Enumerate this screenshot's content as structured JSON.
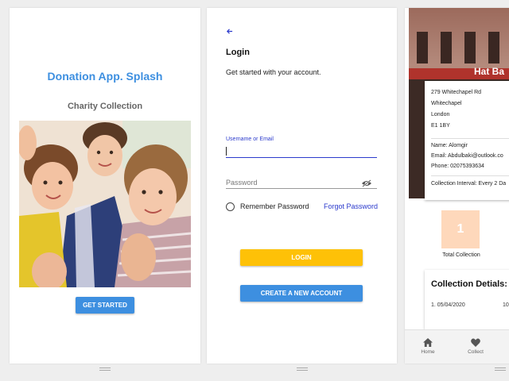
{
  "splash": {
    "title": "Donation App. Splash",
    "subtitle": "Charity Collection",
    "get_started": "GET STARTED"
  },
  "login": {
    "back_icon": "arrow-left-icon",
    "heading": "Login",
    "subtitle": "Get started with your account.",
    "username_label": "Username or Email",
    "username_value": "",
    "password_placeholder": "Password",
    "visibility_icon": "eye-off-icon",
    "remember_label": "Remember Password",
    "forgot_label": "Forgot Password",
    "login_button": "LOGIN",
    "create_button": "CREATE A NEW ACCOUNT",
    "colors": {
      "accent": "#2b3acc",
      "login": "#fec107",
      "primary": "#3d8fe0"
    }
  },
  "shop": {
    "name": "Hat Ba",
    "address": [
      "279 Whitechapel Rd",
      "Whitechapel",
      "London",
      "E1 1BY"
    ],
    "contact_name": "Name: Alomgir",
    "contact_email": "Email: Abdulbaki@outlook.co",
    "contact_phone": "Phone: 02075393634",
    "interval": "Collection Interval: Every 2 Da",
    "total_count": "1",
    "total_label": "Total Collection",
    "details_title": "Collection Detials:",
    "details_date": "1. 05/04/2020",
    "details_value": "10",
    "nav": [
      {
        "label": "Home",
        "icon": "home-icon"
      },
      {
        "label": "Collect",
        "icon": "heart-icon"
      }
    ]
  }
}
